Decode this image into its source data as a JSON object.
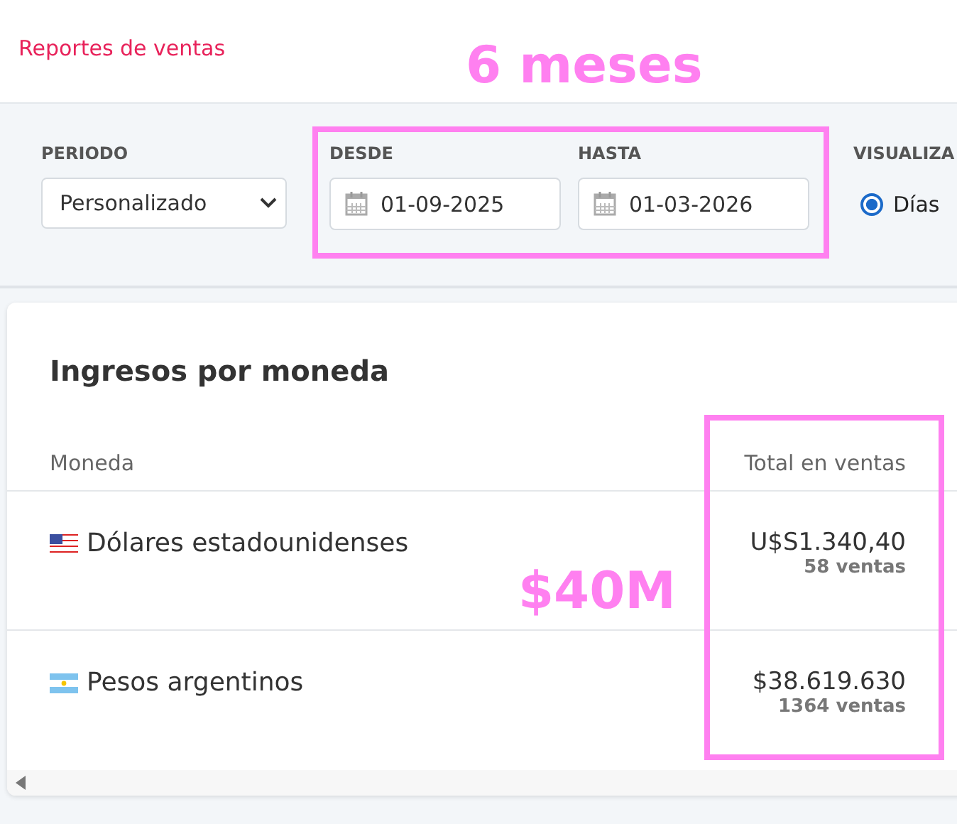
{
  "header": {
    "title": "Reportes de ventas"
  },
  "filters": {
    "period": {
      "label": "PERIODO",
      "value": "Personalizado"
    },
    "from": {
      "label": "DESDE",
      "value": "01-09-2025"
    },
    "to": {
      "label": "HASTA",
      "value": "01-03-2026"
    },
    "view": {
      "label": "VISUALIZA",
      "options": [
        {
          "label": "Días",
          "selected": true
        }
      ]
    }
  },
  "card": {
    "title": "Ingresos por moneda",
    "columns": [
      "Moneda",
      "Total en ventas"
    ],
    "rows": [
      {
        "kind": "us",
        "currency": "Dólares estadounidenses",
        "total": "U$S1.340,40",
        "count": "58 ventas"
      },
      {
        "kind": "ar",
        "currency": "Pesos argentinos",
        "total": "$38.619.630",
        "count": "1364 ventas"
      }
    ]
  },
  "annotations": [
    {
      "kind": "label",
      "text": "6 meses"
    },
    {
      "kind": "frame"
    },
    {
      "kind": "label",
      "text": "$40M"
    },
    {
      "kind": "frame"
    }
  ]
}
